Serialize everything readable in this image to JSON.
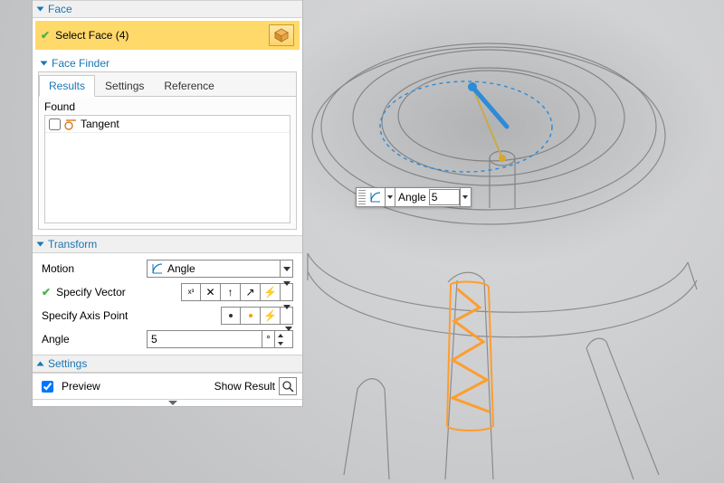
{
  "sections": {
    "face": {
      "title": "Face",
      "expanded": true
    },
    "face_finder": {
      "title": "Face Finder",
      "expanded": true
    },
    "transform": {
      "title": "Transform",
      "expanded": true
    },
    "settings": {
      "title": "Settings",
      "expanded": false
    }
  },
  "face": {
    "select_label": "Select Face (4)",
    "cube_icon": "cube-icon"
  },
  "face_finder": {
    "tabs": {
      "results": "Results",
      "settings": "Settings",
      "reference": "Reference"
    },
    "active_tab": "Results",
    "found_label": "Found",
    "items": [
      {
        "label": "Tangent",
        "checked": false,
        "icon": "tangent-icon"
      }
    ]
  },
  "transform": {
    "motion_label": "Motion",
    "motion_value": "Angle",
    "motion_icon": "angle-icon",
    "specify_vector_label": "Specify Vector",
    "specify_vector_valid": true,
    "vector_buttons": [
      "expr-icon",
      "swap-icon",
      "axis-up-icon",
      "axis-diag-icon",
      "lightning-icon"
    ],
    "specify_axis_label": "Specify Axis Point",
    "axis_buttons": [
      "point-dark-icon",
      "point-light-icon",
      "lightning-icon"
    ],
    "angle_label": "Angle",
    "angle_value": "5",
    "angle_unit": "°"
  },
  "footer": {
    "preview_label": "Preview",
    "preview_checked": true,
    "show_result_label": "Show Result"
  },
  "float": {
    "label": "Angle",
    "value": "5"
  },
  "colors": {
    "brand": "#1976b3",
    "highlight": "#ffd96a",
    "selection_stroke": "#ff9d2e",
    "manipulator": "#2d8bd9"
  }
}
